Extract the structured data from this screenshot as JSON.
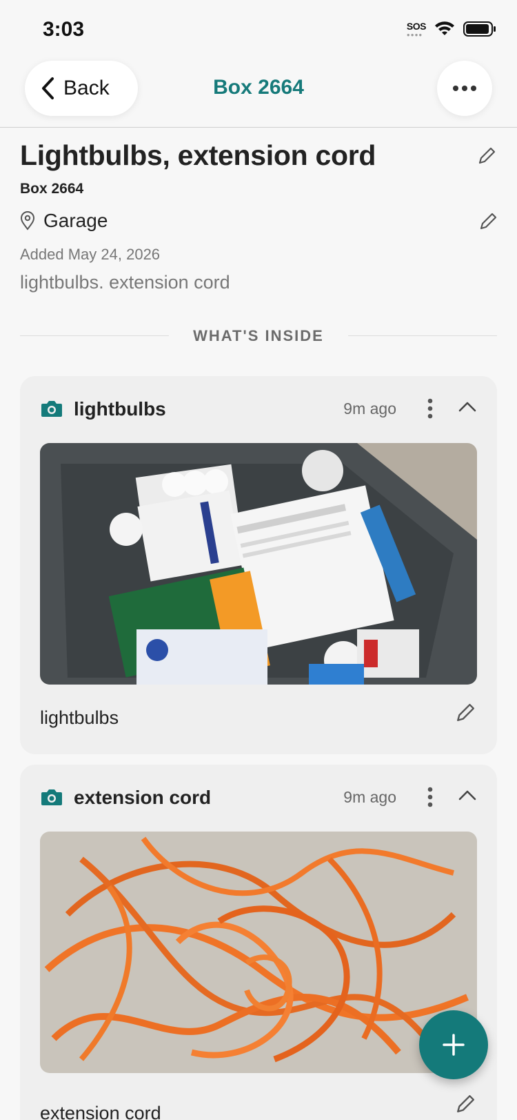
{
  "status_bar": {
    "time": "3:03",
    "sos": "SOS"
  },
  "nav": {
    "back_label": "Back",
    "title": "Box 2664"
  },
  "box": {
    "title": "Lightbulbs, extension cord",
    "subtitle": "Box 2664",
    "location": "Garage",
    "added": "Added May 24, 2026",
    "description": "lightbulbs. extension cord"
  },
  "section_label": "WHAT'S INSIDE",
  "items": [
    {
      "title": "lightbulbs",
      "time": "9m ago",
      "caption": "lightbulbs"
    },
    {
      "title": "extension cord",
      "time": "9m ago",
      "caption": "extension cord"
    }
  ],
  "colors": {
    "accent": "#167a7a",
    "fab": "#147a7a"
  }
}
